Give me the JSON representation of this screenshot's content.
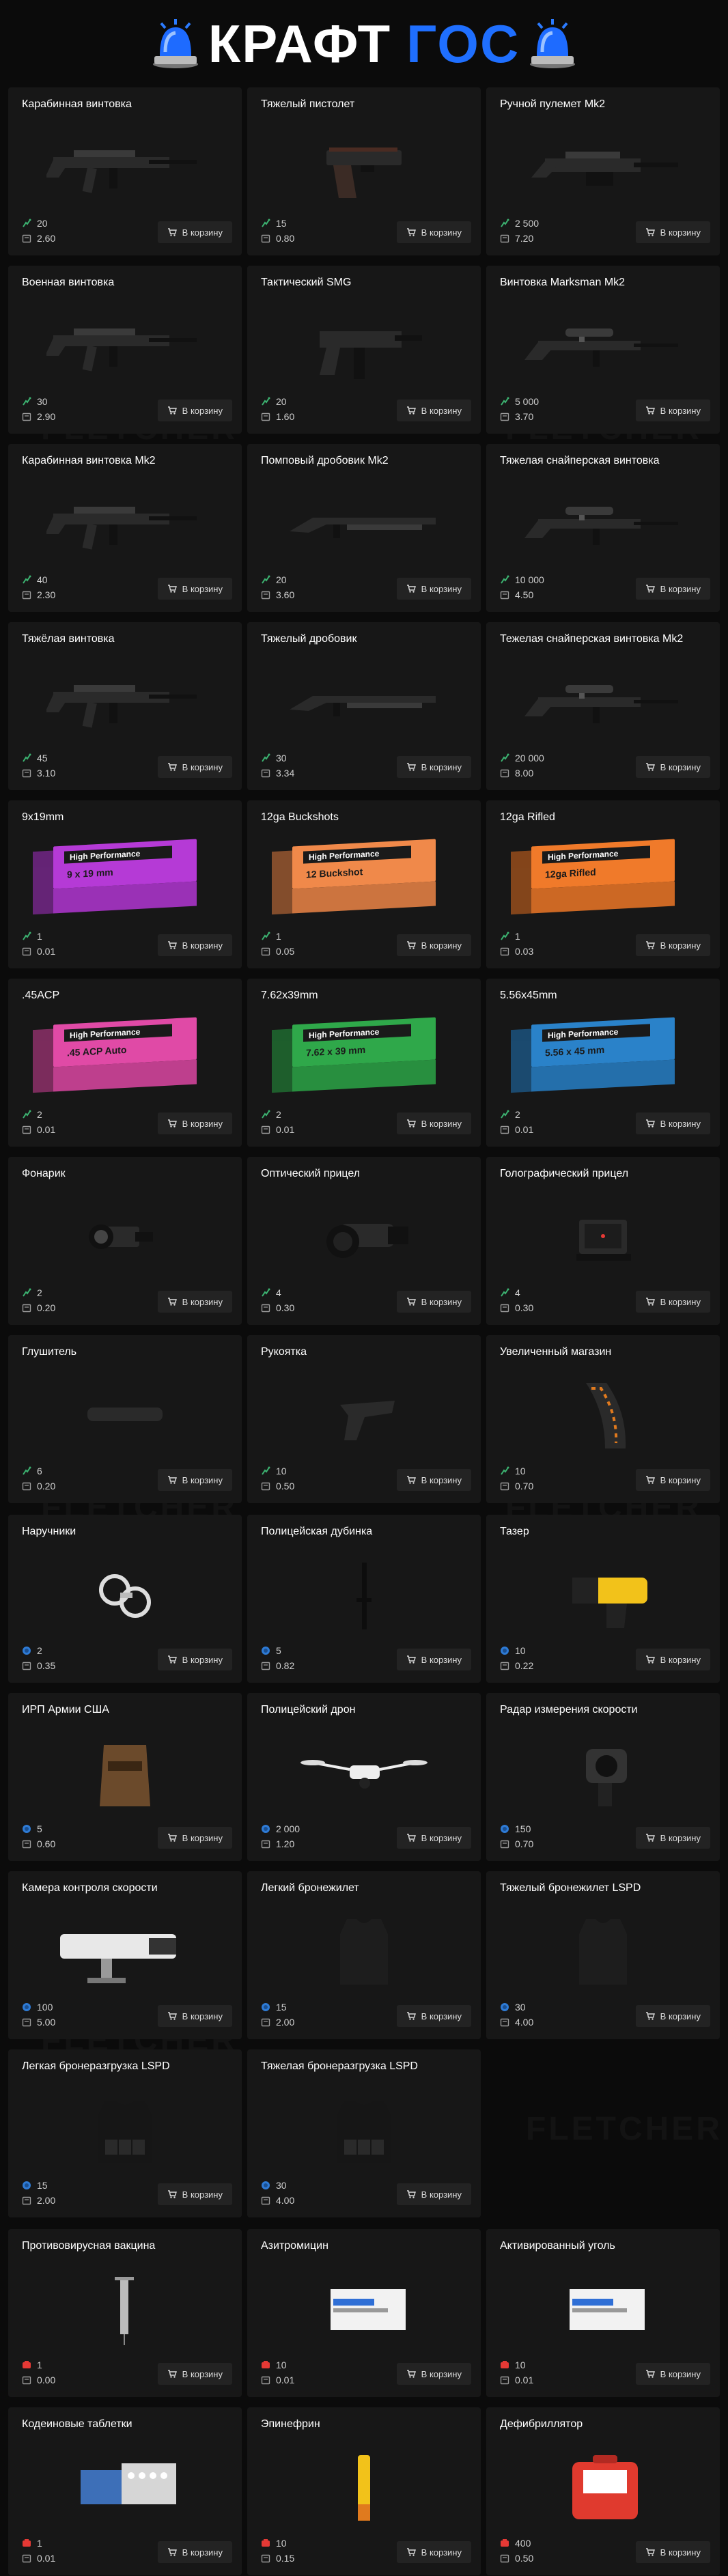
{
  "header": {
    "title_part1": "КРАФТ",
    "title_part2": "ГОС",
    "siren_icon": "police-siren-icon"
  },
  "watermark": "FLETCHER",
  "colors": {
    "accent": "#1f6fff",
    "green": "#3cb371",
    "blue": "#2e7bd6",
    "red": "#e53935",
    "card": "#171717",
    "button": "#232323"
  },
  "button_label": "В корзину",
  "sections": [
    {
      "currency_icon": "green-resource-icon",
      "items": [
        {
          "title": "Карабинная винтовка",
          "cost": "20",
          "weight": "2.60",
          "icon": "rifle-icon"
        },
        {
          "title": "Тяжелый пистолет",
          "cost": "15",
          "weight": "0.80",
          "icon": "pistol-icon"
        },
        {
          "title": "Ручной пулемет Mk2",
          "cost": "2 500",
          "weight": "7.20",
          "icon": "machinegun-icon"
        },
        {
          "title": "Военная винтовка",
          "cost": "30",
          "weight": "2.90",
          "icon": "rifle-icon"
        },
        {
          "title": "Тактический SMG",
          "cost": "20",
          "weight": "1.60",
          "icon": "smg-icon"
        },
        {
          "title": "Винтовка Marksman Mk2",
          "cost": "5 000",
          "weight": "3.70",
          "icon": "sniper-rifle-icon"
        },
        {
          "title": "Карабинная винтовка Mk2",
          "cost": "40",
          "weight": "2.30",
          "icon": "rifle-icon"
        },
        {
          "title": "Помповый дробовик Mk2",
          "cost": "20",
          "weight": "3.60",
          "icon": "shotgun-icon"
        },
        {
          "title": "Тяжелая снайперская винтовка",
          "cost": "10 000",
          "weight": "4.50",
          "icon": "sniper-rifle-icon"
        },
        {
          "title": "Тяжёлая винтовка",
          "cost": "45",
          "weight": "3.10",
          "icon": "rifle-icon"
        },
        {
          "title": "Тяжелый дробовик",
          "cost": "30",
          "weight": "3.34",
          "icon": "shotgun-icon"
        },
        {
          "title": "Тежелая снайперская винтовка Mk2",
          "cost": "20 000",
          "weight": "8.00",
          "icon": "sniper-rifle-icon"
        },
        {
          "title": "9x19mm",
          "cost": "1",
          "weight": "0.01",
          "icon": "ammo-box-icon",
          "box_color": "#b53ad6",
          "box_text": "9 x 19 mm"
        },
        {
          "title": "12ga Buckshots",
          "cost": "1",
          "weight": "0.05",
          "icon": "ammo-box-icon",
          "box_color": "#f0894a",
          "box_text": "12 Buckshot"
        },
        {
          "title": "12ga Rifled",
          "cost": "1",
          "weight": "0.03",
          "icon": "ammo-box-icon",
          "box_color": "#f07a2a",
          "box_text": "12ga Rifled"
        },
        {
          "title": ".45ACP",
          "cost": "2",
          "weight": "0.01",
          "icon": "ammo-box-icon",
          "box_color": "#e04aa6",
          "box_text": ".45 ACP Auto"
        },
        {
          "title": "7.62x39mm",
          "cost": "2",
          "weight": "0.01",
          "icon": "ammo-box-icon",
          "box_color": "#2fa84a",
          "box_text": "7.62 x 39 mm"
        },
        {
          "title": "5.56x45mm",
          "cost": "2",
          "weight": "0.01",
          "icon": "ammo-box-icon",
          "box_color": "#2a82c9",
          "box_text": "5.56 x 45 mm"
        },
        {
          "title": "Фонарик",
          "cost": "2",
          "weight": "0.20",
          "icon": "flashlight-icon"
        },
        {
          "title": "Оптический прицел",
          "cost": "4",
          "weight": "0.30",
          "icon": "scope-icon"
        },
        {
          "title": "Голографический прицел",
          "cost": "4",
          "weight": "0.30",
          "icon": "holo-sight-icon"
        },
        {
          "title": "Глушитель",
          "cost": "6",
          "weight": "0.20",
          "icon": "suppressor-icon"
        },
        {
          "title": "Рукоятка",
          "cost": "10",
          "weight": "0.50",
          "icon": "grip-icon"
        },
        {
          "title": "Увеличенный магазин",
          "cost": "10",
          "weight": "0.70",
          "icon": "magazine-icon"
        }
      ]
    },
    {
      "currency_icon": "blue-resource-icon",
      "items": [
        {
          "title": "Наручники",
          "cost": "2",
          "weight": "0.35",
          "icon": "handcuffs-icon"
        },
        {
          "title": "Полицейская дубинка",
          "cost": "5",
          "weight": "0.82",
          "icon": "baton-icon"
        },
        {
          "title": "Тазер",
          "cost": "10",
          "weight": "0.22",
          "icon": "taser-icon"
        },
        {
          "title": "ИРП Армии США",
          "cost": "5",
          "weight": "0.60",
          "icon": "ration-pack-icon"
        },
        {
          "title": "Полицейский дрон",
          "cost": "2 000",
          "weight": "1.20",
          "icon": "drone-icon"
        },
        {
          "title": "Радар измерения скорости",
          "cost": "150",
          "weight": "0.70",
          "icon": "speed-radar-icon"
        },
        {
          "title": "Камера контроля скорости",
          "cost": "100",
          "weight": "5.00",
          "icon": "speed-camera-icon"
        },
        {
          "title": "Легкий бронежилет",
          "cost": "15",
          "weight": "2.00",
          "icon": "vest-icon"
        },
        {
          "title": "Тяжелый бронежилет LSPD",
          "cost": "30",
          "weight": "4.00",
          "icon": "vest-icon"
        },
        {
          "title": "Легкая бронеразгрузка LSPD",
          "cost": "15",
          "weight": "2.00",
          "icon": "tactical-vest-icon"
        },
        {
          "title": "Тяжелая бронеразгрузка LSPD",
          "cost": "30",
          "weight": "4.00",
          "icon": "tactical-vest-icon"
        },
        {
          "empty": true
        }
      ]
    },
    {
      "currency_icon": "red-resource-icon",
      "items": [
        {
          "title": "Противовирусная вакцина",
          "cost": "1",
          "weight": "0.00",
          "icon": "syringe-icon"
        },
        {
          "title": "Азитромицин",
          "cost": "10",
          "weight": "0.01",
          "icon": "medicine-box-icon"
        },
        {
          "title": "Активированный уголь",
          "cost": "10",
          "weight": "0.01",
          "icon": "medicine-box-icon"
        },
        {
          "title": "Кодеиновые таблетки",
          "cost": "1",
          "weight": "0.01",
          "icon": "pills-icon"
        },
        {
          "title": "Эпинефрин",
          "cost": "10",
          "weight": "0.15",
          "icon": "epipen-icon"
        },
        {
          "title": "Дефибриллятор",
          "cost": "400",
          "weight": "0.50",
          "icon": "defibrillator-icon"
        }
      ]
    }
  ]
}
